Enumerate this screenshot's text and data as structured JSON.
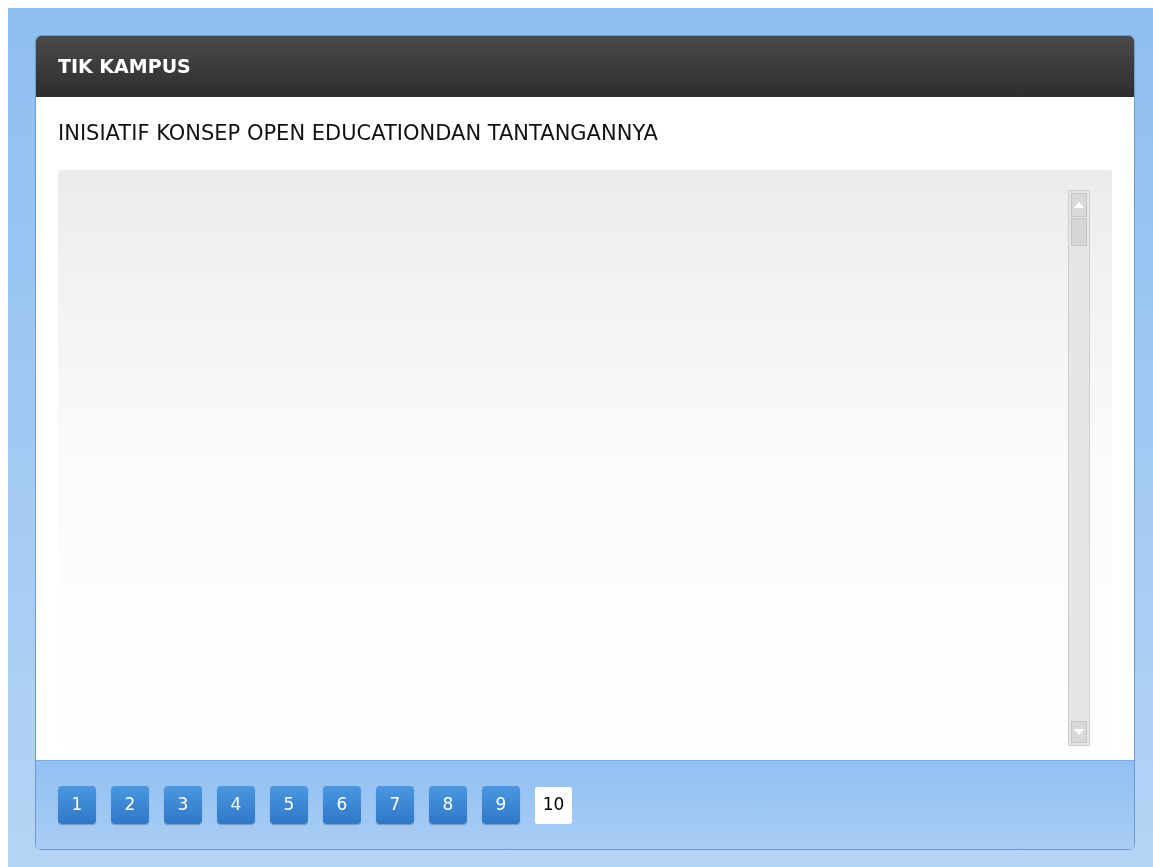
{
  "header": {
    "title": "TIK KAMPUS"
  },
  "content": {
    "title": "INISIATIF KONSEP OPEN EDUCATIONDAN TANTANGANNYA"
  },
  "pagination": [
    {
      "label": "1",
      "selected": false
    },
    {
      "label": "2",
      "selected": false
    },
    {
      "label": "3",
      "selected": false
    },
    {
      "label": "4",
      "selected": false
    },
    {
      "label": "5",
      "selected": false
    },
    {
      "label": "6",
      "selected": false
    },
    {
      "label": "7",
      "selected": false
    },
    {
      "label": "8",
      "selected": false
    },
    {
      "label": "9",
      "selected": false
    },
    {
      "label": "10",
      "selected": true
    }
  ]
}
